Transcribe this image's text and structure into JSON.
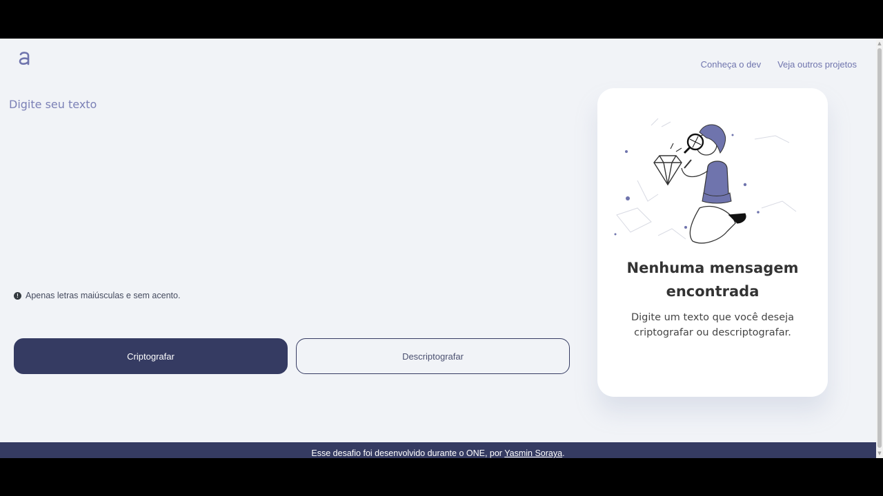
{
  "colors": {
    "accent": "#353b62",
    "nav_text": "#6f74ad",
    "page_bg": "#f1f3f7",
    "card_bg": "#ffffff"
  },
  "header": {
    "logo_icon": "alura-logo-icon",
    "nav": {
      "dev_link": "Conheça o dev",
      "projects_link": "Veja outros projetos"
    }
  },
  "input": {
    "placeholder": "Digite seu texto",
    "value": ""
  },
  "hint": {
    "icon": "exclamation-circle-icon",
    "text": "Apenas letras maiúsculas e sem acento."
  },
  "buttons": {
    "encrypt_label": "Criptografar",
    "decrypt_label": "Descriptografar"
  },
  "output_card": {
    "illustration": "person-with-magnifying-glass-illustration",
    "title": "Nenhuma mensagem encontrada",
    "description": "Digite um texto que você deseja criptografar ou descriptografar."
  },
  "footer": {
    "text_before": "Esse desafio foi desenvolvido durante o ONE, por ",
    "author_link": "Yasmin Soraya",
    "text_after": "."
  }
}
